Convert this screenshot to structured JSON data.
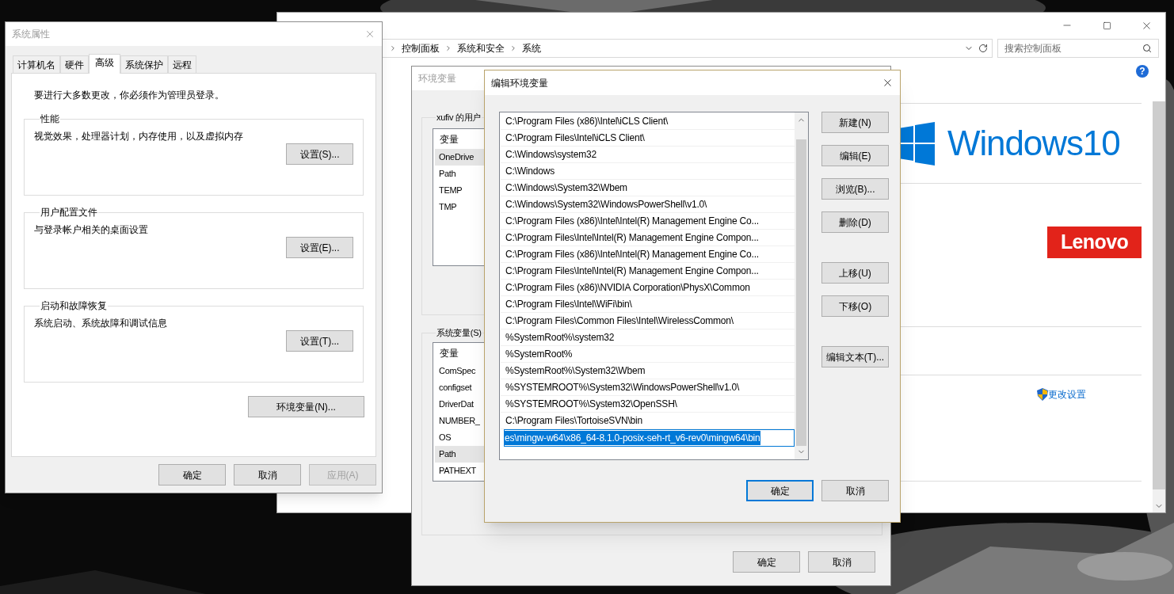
{
  "control_panel": {
    "breadcrumb": [
      "控制面板",
      "系统和安全",
      "系统"
    ],
    "search": {
      "placeholder": "搜索控制面板"
    },
    "help": "?",
    "windows_logo": "Windows10",
    "lenovo_logo": "Lenovo",
    "change_settings_link": "更改设置"
  },
  "system_properties": {
    "title": "系统属性",
    "tabs": [
      {
        "label": "计算机名",
        "selected": false
      },
      {
        "label": "硬件",
        "selected": false
      },
      {
        "label": "高级",
        "selected": true
      },
      {
        "label": "系统保护",
        "selected": false
      },
      {
        "label": "远程",
        "selected": false
      }
    ],
    "notice": "要进行大多数更改，你必须作为管理员登录。",
    "groups": [
      {
        "title": "性能",
        "description": "视觉效果，处理器计划，内存使用，以及虚拟内存",
        "button": "设置(S)..."
      },
      {
        "title": "用户配置文件",
        "description": "与登录帐户相关的桌面设置",
        "button": "设置(E)..."
      },
      {
        "title": "启动和故障恢复",
        "description": "系统启动、系统故障和调试信息",
        "button": "设置(T)..."
      }
    ],
    "env_button": "环境变量(N)...",
    "buttons": [
      {
        "label": "确定",
        "disabled": false
      },
      {
        "label": "取消",
        "disabled": false
      },
      {
        "label": "应用(A)",
        "disabled": true
      }
    ]
  },
  "env_window": {
    "title": "环境变量",
    "user_group": {
      "label": "xufiv 的用户",
      "header": "变量",
      "rows": [
        {
          "name": "OneDrive",
          "selected": true
        },
        {
          "name": "Path",
          "selected": false
        },
        {
          "name": "TEMP",
          "selected": false
        },
        {
          "name": "TMP",
          "selected": false
        }
      ]
    },
    "system_group": {
      "label": "系统变量(S)",
      "header": "变量",
      "rows": [
        {
          "name": "ComSpec",
          "selected": false
        },
        {
          "name": "configset",
          "selected": false
        },
        {
          "name": "DriverDat",
          "selected": false
        },
        {
          "name": "NUMBER_",
          "selected": false
        },
        {
          "name": "OS",
          "selected": false
        },
        {
          "name": "Path",
          "selected": true
        },
        {
          "name": "PATHEXT",
          "selected": false
        }
      ]
    },
    "buttons": [
      "确定",
      "取消"
    ]
  },
  "edit_window": {
    "title": "编辑环境变量",
    "paths": [
      {
        "text": "C:\\Program Files (x86)\\Intel\\iCLS Client\\",
        "selected": false
      },
      {
        "text": "C:\\Program Files\\Intel\\iCLS Client\\",
        "selected": false
      },
      {
        "text": "C:\\Windows\\system32",
        "selected": false
      },
      {
        "text": "C:\\Windows",
        "selected": false
      },
      {
        "text": "C:\\Windows\\System32\\Wbem",
        "selected": false
      },
      {
        "text": "C:\\Windows\\System32\\WindowsPowerShell\\v1.0\\",
        "selected": false
      },
      {
        "text": "C:\\Program Files (x86)\\Intel\\Intel(R) Management Engine Co...",
        "selected": false
      },
      {
        "text": "C:\\Program Files\\Intel\\Intel(R) Management Engine Compon...",
        "selected": false
      },
      {
        "text": "C:\\Program Files (x86)\\Intel\\Intel(R) Management Engine Co...",
        "selected": false
      },
      {
        "text": "C:\\Program Files\\Intel\\Intel(R) Management Engine Compon...",
        "selected": false
      },
      {
        "text": "C:\\Program Files (x86)\\NVIDIA Corporation\\PhysX\\Common",
        "selected": false
      },
      {
        "text": "C:\\Program Files\\Intel\\WiFi\\bin\\",
        "selected": false
      },
      {
        "text": "C:\\Program Files\\Common Files\\Intel\\WirelessCommon\\",
        "selected": false
      },
      {
        "text": "%SystemRoot%\\system32",
        "selected": false
      },
      {
        "text": "%SystemRoot%",
        "selected": false
      },
      {
        "text": "%SystemRoot%\\System32\\Wbem",
        "selected": false
      },
      {
        "text": "%SYSTEMROOT%\\System32\\WindowsPowerShell\\v1.0\\",
        "selected": false
      },
      {
        "text": "%SYSTEMROOT%\\System32\\OpenSSH\\",
        "selected": false
      },
      {
        "text": "C:\\Program Files\\TortoiseSVN\\bin",
        "selected": false
      },
      {
        "text": "es\\mingw-w64\\x86_64-8.1.0-posix-seh-rt_v6-rev0\\mingw64\\bin",
        "selected": true
      }
    ],
    "side_buttons": [
      {
        "label": "新建(N)",
        "kind": "button"
      },
      {
        "label": "编辑(E)",
        "kind": "button"
      },
      {
        "label": "浏览(B)...",
        "kind": "button"
      },
      {
        "label": "删除(D)",
        "kind": "button"
      },
      {
        "label": "上移(U)",
        "kind": "gap"
      },
      {
        "label": "下移(O)",
        "kind": "button"
      },
      {
        "label": "编辑文本(T)...",
        "kind": "gap"
      }
    ],
    "buttons": [
      {
        "label": "确定",
        "default": true
      },
      {
        "label": "取消",
        "default": false
      }
    ]
  }
}
